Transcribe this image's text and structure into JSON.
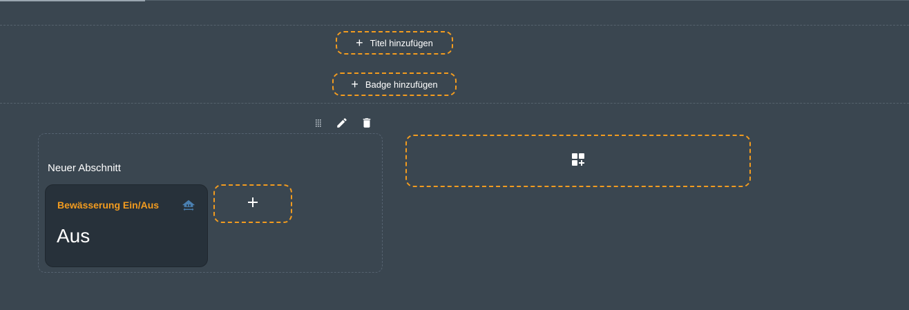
{
  "header": {
    "add_title_label": "Titel hinzufügen",
    "add_badge_label": "Badge hinzufügen"
  },
  "section": {
    "title": "Neuer Abschnitt",
    "toolbar": {
      "icons": [
        "drag-handle-icon",
        "pencil-icon",
        "trash-icon"
      ]
    },
    "cards": [
      {
        "name": "Bewässerung Ein/Aus",
        "state": "Aus",
        "icon": "home-switch-icon"
      }
    ]
  },
  "add_section": {
    "icon": "grid-plus-icon"
  },
  "colors": {
    "background": "#3a4650",
    "accent": "#f39c1f",
    "card_background": "#27313a",
    "icon_blue": "#4a7fb0"
  }
}
